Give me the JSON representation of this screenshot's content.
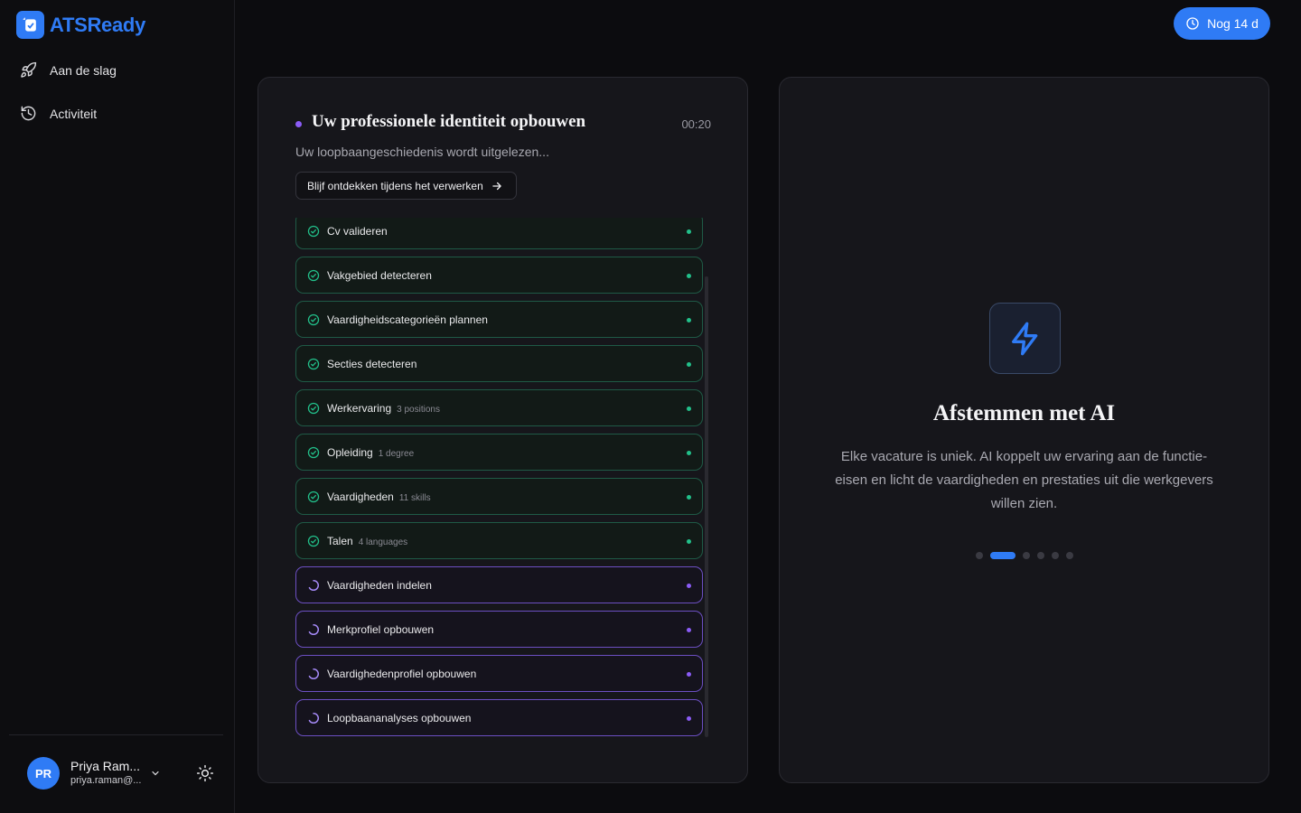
{
  "brand": {
    "name_part1": "ATS",
    "name_part2": "Ready"
  },
  "sidebar": {
    "items": [
      {
        "label": "Aan de slag",
        "icon": "rocket-icon"
      },
      {
        "label": "Activiteit",
        "icon": "history-icon"
      }
    ],
    "user": {
      "initials": "PR",
      "name": "Priya Ram...",
      "email": "priya.raman@..."
    }
  },
  "header": {
    "trial_label": "Nog 14 d"
  },
  "progress": {
    "title": "Uw professionele identiteit opbouwen",
    "timer": "00:20",
    "subtitle": "Uw loopbaangeschiedenis wordt uitgelezen...",
    "explore_label": "Blijf ontdekken tijdens het verwerken",
    "steps": [
      {
        "label": "Cv valideren",
        "meta": "",
        "status": "done"
      },
      {
        "label": "Vakgebied detecteren",
        "meta": "",
        "status": "done"
      },
      {
        "label": "Vaardigheidscategorieën plannen",
        "meta": "",
        "status": "done"
      },
      {
        "label": "Secties detecteren",
        "meta": "",
        "status": "done"
      },
      {
        "label": "Werkervaring",
        "meta": "3 positions",
        "status": "done"
      },
      {
        "label": "Opleiding",
        "meta": "1 degree",
        "status": "done"
      },
      {
        "label": "Vaardigheden",
        "meta": "11 skills",
        "status": "done"
      },
      {
        "label": "Talen",
        "meta": "4 languages",
        "status": "done"
      },
      {
        "label": "Vaardigheden indelen",
        "meta": "",
        "status": "active"
      },
      {
        "label": "Merkprofiel opbouwen",
        "meta": "",
        "status": "active"
      },
      {
        "label": "Vaardighedenprofiel opbouwen",
        "meta": "",
        "status": "active"
      },
      {
        "label": "Loopbaananalyses opbouwen",
        "meta": "",
        "status": "active"
      }
    ]
  },
  "feature": {
    "icon": "lightning-icon",
    "title": "Afstemmen met AI",
    "description": "Elke vacature is uniek. AI koppelt uw ervaring aan de functie-eisen en licht de vaardigheden en prestaties uit die werkgevers willen zien.",
    "slide_count": 6,
    "active_slide": 2
  },
  "colors": {
    "accent": "#2f7bf5",
    "done": "#22c08a",
    "active": "#8b5cf6",
    "background": "#0c0c0f"
  }
}
